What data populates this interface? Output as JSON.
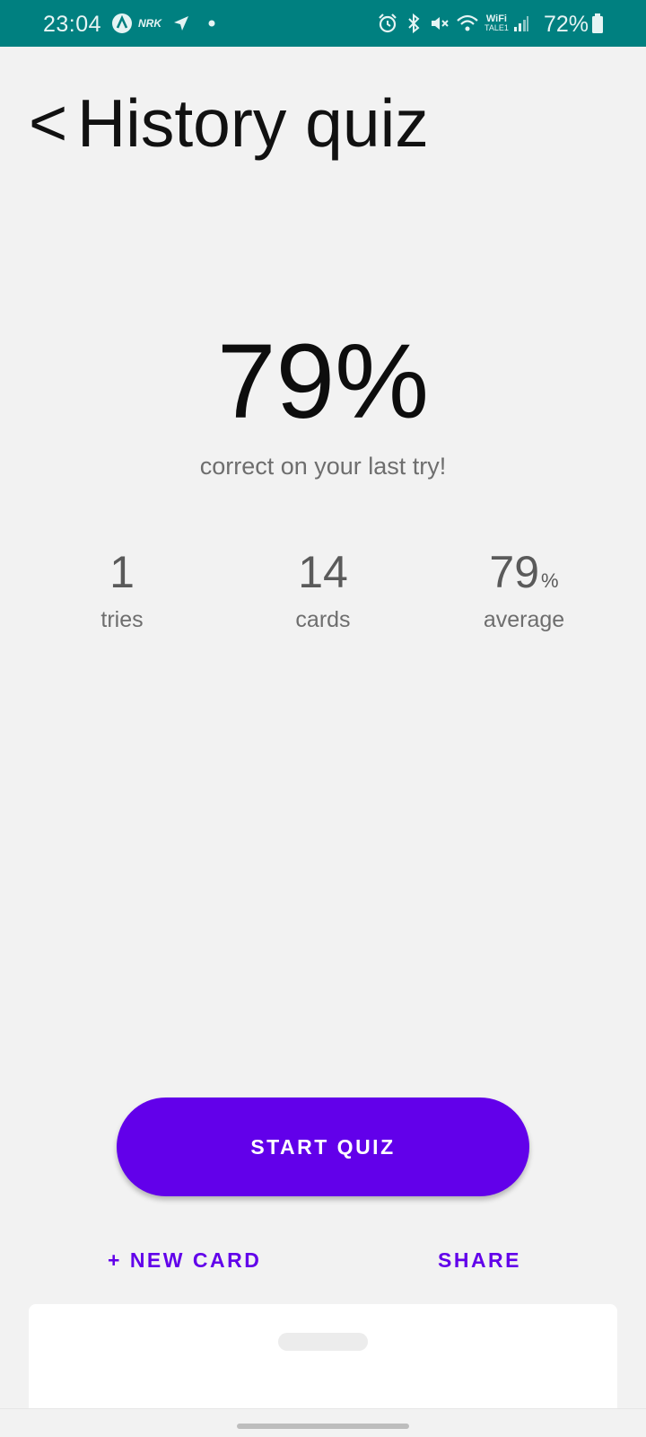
{
  "status_bar": {
    "time": "23:04",
    "nrk_label": "NRK",
    "wifi_label": "WiFi",
    "wifi_sub": "TALE1",
    "battery": "72%",
    "icons": [
      "app-a-icon",
      "nrk-icon",
      "location-arrow-icon",
      "dot-icon",
      "alarm-icon",
      "bluetooth-icon",
      "mute-icon",
      "wifi-icon",
      "signal-icon",
      "battery-icon"
    ]
  },
  "header": {
    "back_symbol": "<",
    "title": "History quiz"
  },
  "score": {
    "percent": "79%",
    "caption": "correct on your last try!"
  },
  "stats": [
    {
      "value": "1",
      "unit": "",
      "label": "tries"
    },
    {
      "value": "14",
      "unit": "",
      "label": "cards"
    },
    {
      "value": "79",
      "unit": "%",
      "label": "average"
    }
  ],
  "actions": {
    "start_quiz": "START QUIZ",
    "new_card": "+ NEW CARD",
    "share": "SHARE"
  },
  "colors": {
    "status_bar": "#008080",
    "accent": "#6200ea",
    "background": "#f2f2f2"
  }
}
